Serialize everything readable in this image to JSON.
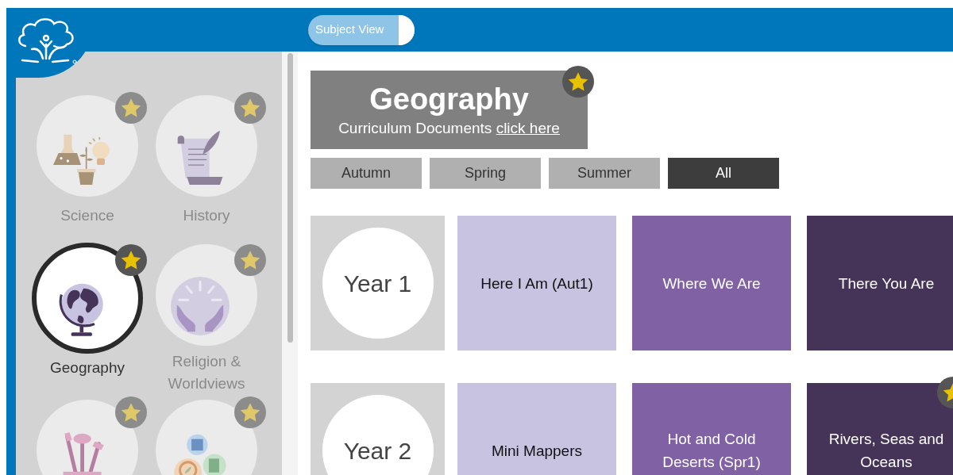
{
  "header": {
    "toggle": {
      "label": "Subject View",
      "on": true
    }
  },
  "sidebar": {
    "subjects": [
      {
        "kind": "science",
        "label": "Science",
        "selected": false
      },
      {
        "kind": "history",
        "label": "History",
        "selected": false
      },
      {
        "kind": "geography",
        "label": "Geography",
        "selected": true
      },
      {
        "kind": "religion",
        "label": "Religion & Worldviews",
        "selected": false
      },
      {
        "kind": "art",
        "selected": false
      },
      {
        "kind": "english",
        "selected": false
      }
    ]
  },
  "title_card": {
    "title": "Geography",
    "subtitle": "Curriculum Documents",
    "link": "click here",
    "favorite": true
  },
  "terms": [
    {
      "label": "Autumn",
      "selected": false
    },
    {
      "label": "Spring",
      "selected": false
    },
    {
      "label": "Summer",
      "selected": false
    },
    {
      "label": "All",
      "selected": true
    }
  ],
  "years": [
    {
      "label": "Year 1",
      "units": [
        {
          "title": "Here I Am (Aut1)",
          "color": "#c9c3e2",
          "favorite": false
        },
        {
          "title": "Where We Are",
          "color": "#8061a3",
          "favorite": false
        },
        {
          "title": "There You Are",
          "color": "#463358",
          "favorite": false
        }
      ]
    },
    {
      "label": "Year 2",
      "units": [
        {
          "title": "Mini Mappers",
          "color": "#c9c3e2",
          "favorite": false
        },
        {
          "title": "Hot and Cold Deserts (Spr1)",
          "color": "#8061a3",
          "favorite": false
        },
        {
          "title": "Rivers, Seas and Oceans",
          "color": "#463358",
          "favorite": true
        }
      ]
    }
  ]
}
